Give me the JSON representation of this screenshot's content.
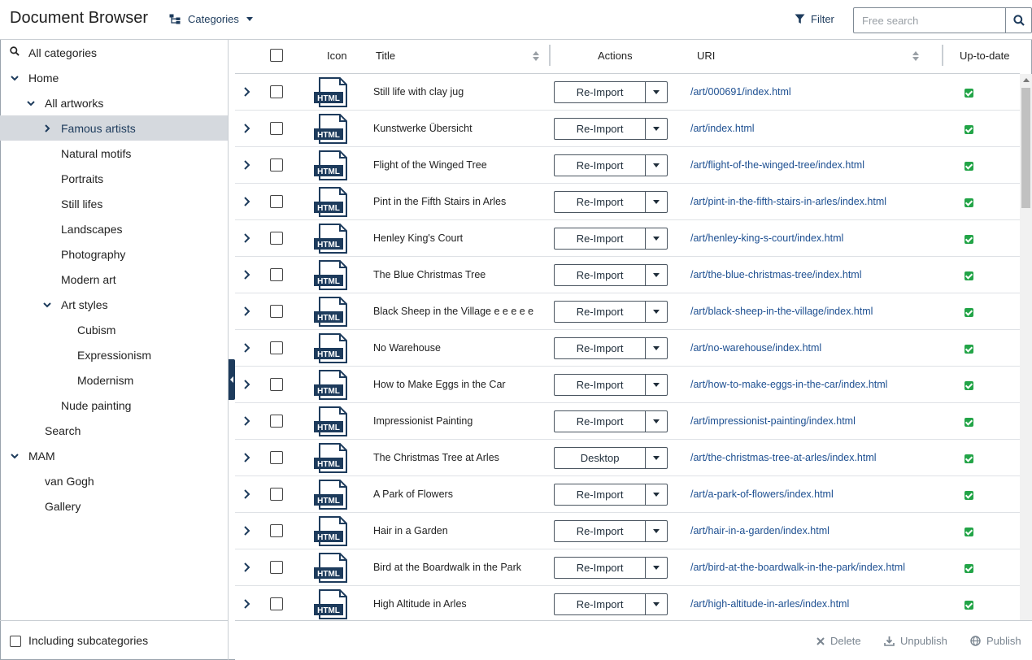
{
  "header": {
    "app_title": "Document Browser",
    "categories_label": "Categories",
    "filter_label": "Filter",
    "search_placeholder": "Free search"
  },
  "sidebar": {
    "items": [
      {
        "label": "All categories",
        "icon": "search-icon"
      },
      {
        "label": "Home",
        "expanded": true
      },
      {
        "label": "All artworks",
        "expanded": true
      },
      {
        "label": "Famous artists",
        "selected": true,
        "collapsed": true
      },
      {
        "label": "Natural motifs"
      },
      {
        "label": "Portraits"
      },
      {
        "label": "Still lifes"
      },
      {
        "label": "Landscapes"
      },
      {
        "label": "Photography"
      },
      {
        "label": "Modern art"
      },
      {
        "label": "Art styles",
        "expanded": true
      },
      {
        "label": "Cubism"
      },
      {
        "label": "Expressionism"
      },
      {
        "label": "Modernism"
      },
      {
        "label": "Nude painting"
      },
      {
        "label": "Search"
      },
      {
        "label": "MAM",
        "expanded": true
      },
      {
        "label": "van Gogh"
      },
      {
        "label": "Gallery"
      }
    ],
    "footer_label": "Including subcategories"
  },
  "table": {
    "columns": {
      "icon": "Icon",
      "title": "Title",
      "actions": "Actions",
      "uri": "URI",
      "uptodate": "Up-to-date"
    },
    "icon_label": "HTML",
    "rows": [
      {
        "title": "Still life with clay jug",
        "action": "Re-Import",
        "uri": "/art/000691/index.html",
        "up_to_date": true
      },
      {
        "title": "Kunstwerke Übersicht",
        "action": "Re-Import",
        "uri": "/art/index.html",
        "up_to_date": true
      },
      {
        "title": "Flight of the Winged Tree",
        "action": "Re-Import",
        "uri": "/art/flight-of-the-winged-tree/index.html",
        "up_to_date": true
      },
      {
        "title": "Pint in the Fifth Stairs in Arles",
        "action": "Re-Import",
        "uri": "/art/pint-in-the-fifth-stairs-in-arles/index.html",
        "up_to_date": true
      },
      {
        "title": "Henley King's Court",
        "action": "Re-Import",
        "uri": "/art/henley-king-s-court/index.html",
        "up_to_date": true
      },
      {
        "title": "The Blue Christmas Tree",
        "action": "Re-Import",
        "uri": "/art/the-blue-christmas-tree/index.html",
        "up_to_date": true
      },
      {
        "title": "Black Sheep in the Village e e e e e",
        "action": "Re-Import",
        "uri": "/art/black-sheep-in-the-village/index.html",
        "up_to_date": true
      },
      {
        "title": "No Warehouse",
        "action": "Re-Import",
        "uri": "/art/no-warehouse/index.html",
        "up_to_date": true
      },
      {
        "title": "How to Make Eggs in the Car",
        "action": "Re-Import",
        "uri": "/art/how-to-make-eggs-in-the-car/index.html",
        "up_to_date": true
      },
      {
        "title": "Impressionist Painting",
        "action": "Re-Import",
        "uri": "/art/impressionist-painting/index.html",
        "up_to_date": true
      },
      {
        "title": "The Christmas Tree at Arles",
        "action": "Desktop",
        "uri": "/art/the-christmas-tree-at-arles/index.html",
        "up_to_date": true
      },
      {
        "title": "A Park of Flowers",
        "action": "Re-Import",
        "uri": "/art/a-park-of-flowers/index.html",
        "up_to_date": true
      },
      {
        "title": "Hair in a Garden",
        "action": "Re-Import",
        "uri": "/art/hair-in-a-garden/index.html",
        "up_to_date": true
      },
      {
        "title": "Bird at the Boardwalk in the Park",
        "action": "Re-Import",
        "uri": "/art/bird-at-the-boardwalk-in-the-park/index.html",
        "up_to_date": true
      },
      {
        "title": "High Altitude in Arles",
        "action": "Re-Import",
        "uri": "/art/high-altitude-in-arles/index.html",
        "up_to_date": true
      }
    ]
  },
  "footer": {
    "delete_label": "Delete",
    "unpublish_label": "Unpublish",
    "publish_label": "Publish"
  },
  "colors": {
    "accent": "#1d3b5c",
    "link": "#1d4f91",
    "status_ok": "#22a447",
    "selected_bg": "#d5d9de"
  }
}
